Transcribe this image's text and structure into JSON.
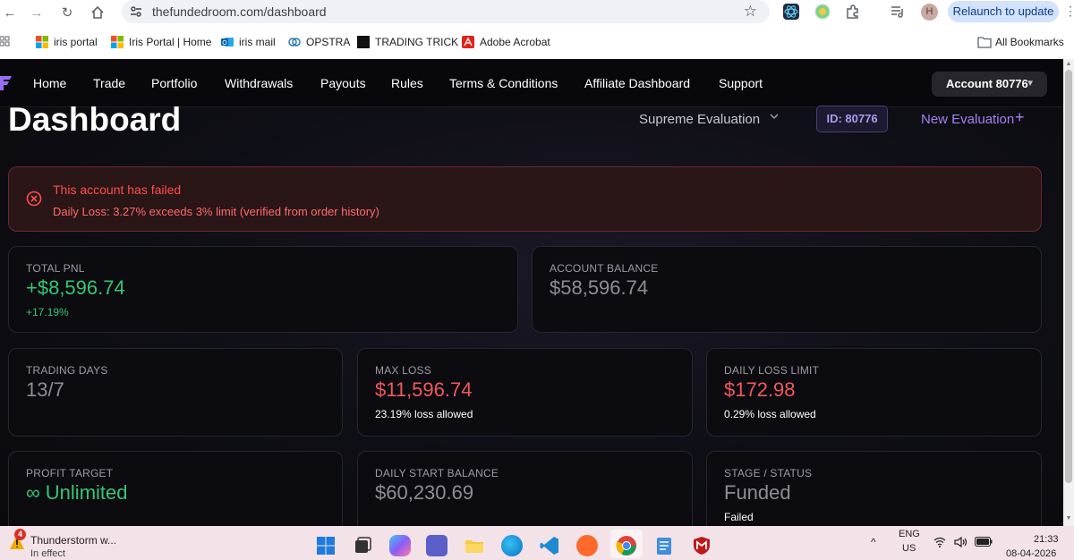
{
  "browser": {
    "url": "thefundedroom.com/dashboard",
    "relaunch_label": "Relaunch to update",
    "profile_initial": "H",
    "bookmarks": [
      {
        "label": "iris portal",
        "icon": "microsoft-icon"
      },
      {
        "label": "Iris Portal | Home",
        "icon": "microsoft-icon"
      },
      {
        "label": "iris mail",
        "icon": "outlook-icon"
      },
      {
        "label": "OPSTRA",
        "icon": "opstra-icon"
      },
      {
        "label": "TRADING TRICK",
        "icon": "trading-trick-icon"
      },
      {
        "label": "Adobe Acrobat",
        "icon": "acrobat-icon"
      }
    ],
    "all_bookmarks_label": "All Bookmarks"
  },
  "nav": {
    "items": [
      "Home",
      "Trade",
      "Portfolio",
      "Withdrawals",
      "Payouts",
      "Rules",
      "Terms & Conditions",
      "Affiliate Dashboard",
      "Support"
    ],
    "account_button": "Account 80776"
  },
  "header": {
    "title": "Dashboard",
    "evaluation_select": "Supreme Evaluation",
    "id_badge": "ID: 80776",
    "new_evaluation": "New Evaluation"
  },
  "alert": {
    "title": "This account has failed",
    "message": "Daily Loss: 3.27% exceeds 3% limit (verified from order history)"
  },
  "cards": {
    "total_pnl": {
      "label": "TOTAL PNL",
      "value": "+$8,596.74",
      "sub": "+17.19%"
    },
    "account_balance": {
      "label": "ACCOUNT BALANCE",
      "value": "$58,596.74"
    },
    "trading_days": {
      "label": "TRADING DAYS",
      "value": "13/7"
    },
    "max_loss": {
      "label": "MAX LOSS",
      "value": "$11,596.74",
      "sub": "23.19% loss allowed"
    },
    "daily_loss_limit": {
      "label": "DAILY LOSS LIMIT",
      "value": "$172.98",
      "sub": "0.29% loss allowed"
    },
    "profit_target": {
      "label": "PROFIT TARGET",
      "value": "∞ Unlimited"
    },
    "daily_start_balance": {
      "label": "DAILY START BALANCE",
      "value": "$60,230.69"
    },
    "stage_status": {
      "label": "STAGE / STATUS",
      "value": "Funded",
      "sub": "Failed"
    }
  },
  "taskbar": {
    "weather_title": "Thunderstorm w...",
    "weather_sub": "In effect",
    "weather_badge": "4",
    "lang_line1": "ENG",
    "lang_line2": "US",
    "time": "21:33",
    "date": "08-04-2026"
  },
  "colors": {
    "accent_purple": "#a87ff5",
    "positive_green": "#36c673",
    "negative_red": "#f05a5a",
    "alert_red": "#ff4d4f"
  }
}
